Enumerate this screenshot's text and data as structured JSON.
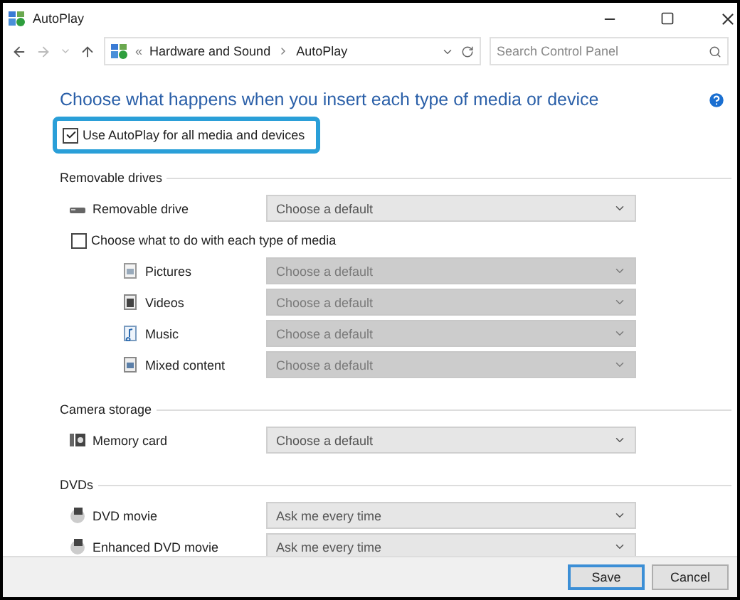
{
  "window": {
    "title": "AutoPlay"
  },
  "address_bar": {
    "overflow": "«",
    "breadcrumb": [
      "Hardware and Sound",
      "AutoPlay"
    ]
  },
  "search": {
    "placeholder": "Search Control Panel"
  },
  "heading": "Choose what happens when you insert each type of media or device",
  "use_autoplay": {
    "label": "Use AutoPlay for all media and devices",
    "checked": true,
    "highlighted": true
  },
  "sections": [
    {
      "title": "Removable drives",
      "items": [
        {
          "kind": "select",
          "label": "Removable drive",
          "value": "Choose a default",
          "disabled": false
        },
        {
          "kind": "checkbox",
          "label": "Choose what to do with each type of media",
          "checked": false,
          "children": [
            {
              "kind": "select",
              "label": "Pictures",
              "value": "Choose a default",
              "disabled": true
            },
            {
              "kind": "select",
              "label": "Videos",
              "value": "Choose a default",
              "disabled": true
            },
            {
              "kind": "select",
              "label": "Music",
              "value": "Choose a default",
              "disabled": true
            },
            {
              "kind": "select",
              "label": "Mixed content",
              "value": "Choose a default",
              "disabled": true
            }
          ]
        }
      ]
    },
    {
      "title": "Camera storage",
      "items": [
        {
          "kind": "select",
          "label": "Memory card",
          "value": "Choose a default",
          "disabled": false
        }
      ]
    },
    {
      "title": "DVDs",
      "items": [
        {
          "kind": "select",
          "label": "DVD movie",
          "value": "Ask me every time",
          "disabled": false
        },
        {
          "kind": "select",
          "label": "Enhanced DVD movie",
          "value": "Ask me every time",
          "disabled": false
        }
      ]
    }
  ],
  "buttons": [
    {
      "label": "Save",
      "default": true
    },
    {
      "label": "Cancel",
      "default": false
    }
  ]
}
